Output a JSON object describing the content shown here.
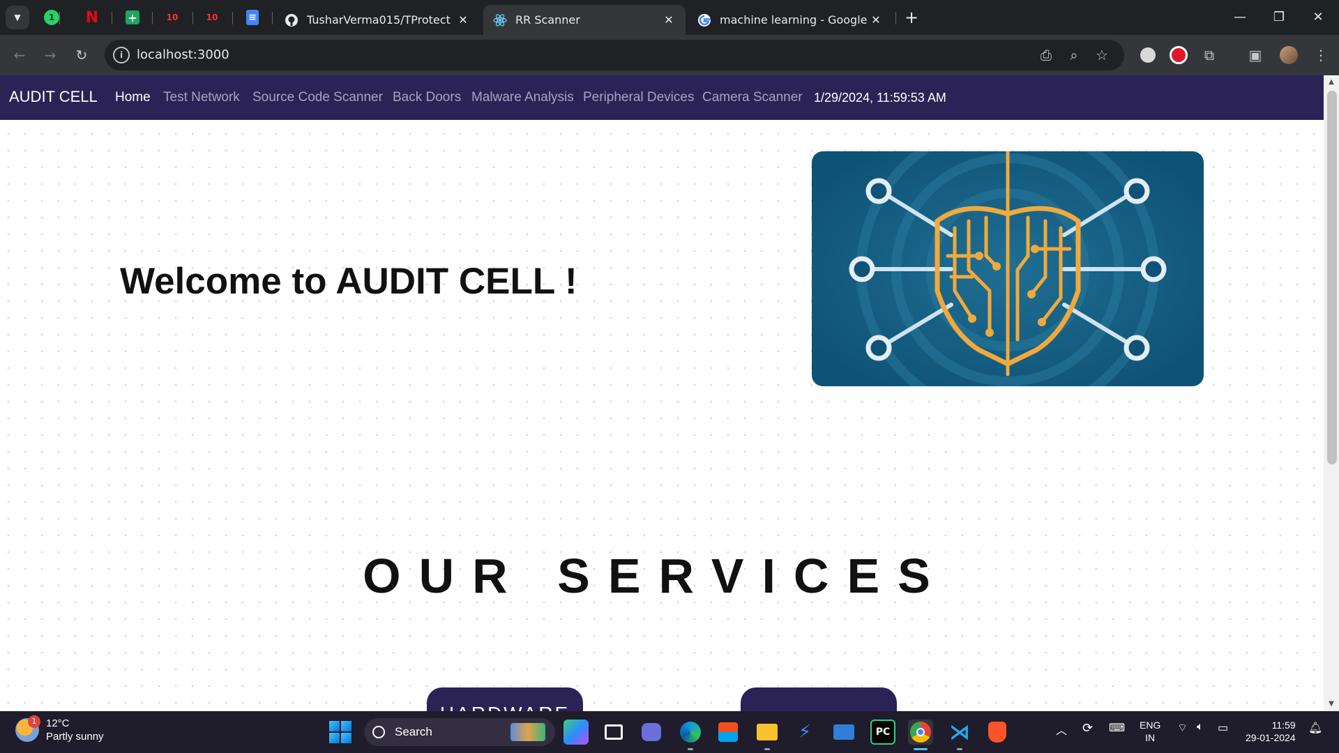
{
  "tabs": [
    {
      "title": "TusharVerma015/TProtect",
      "favicon": "github-icon",
      "active": false
    },
    {
      "title": "RR Scanner",
      "favicon": "react-icon",
      "active": true
    },
    {
      "title": "machine learning - Google Sea",
      "favicon": "google-icon",
      "active": false
    }
  ],
  "pinned_tabs": [
    "whatsapp-icon",
    "netflix-icon",
    "google-sheets-icon",
    "ten-icon",
    "ten-icon",
    "google-docs-icon"
  ],
  "whatsapp_badge": "1",
  "omnibox": {
    "url": "localhost:3000"
  },
  "navbar": {
    "brand": "AUDIT CELL",
    "links": [
      "Home",
      "Test Network",
      "Source Code Scanner",
      "Back Doors",
      "Malware Analysis",
      "Peripheral Devices",
      "Camera Scanner"
    ],
    "active_link": "Home",
    "clock": "1/29/2024, 11:59:53 AM"
  },
  "hero": {
    "heading": "Welcome to AUDIT CELL !",
    "image": "circuit-shield-brain-image"
  },
  "services": {
    "title": "OUR SERVICES",
    "cards": [
      "HARDWARE",
      ""
    ]
  },
  "taskbar": {
    "weather_temp": "12°C",
    "weather_desc": "Partly sunny",
    "weather_badge": "1",
    "search_label": "Search",
    "lang_line1": "ENG",
    "lang_line2": "IN",
    "time": "11:59",
    "date": "29-01-2024"
  },
  "colors": {
    "navbar": "#2b2356",
    "tab_active": "#35363a",
    "browser_bg": "#202124",
    "taskbar": "#1f1c2b"
  }
}
